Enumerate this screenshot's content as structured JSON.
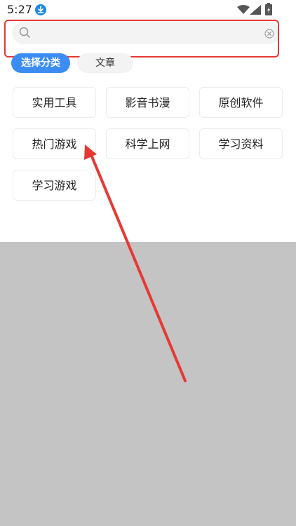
{
  "status_bar": {
    "time": "5:27",
    "icons": [
      "download-icon",
      "wifi-icon",
      "signal-icon",
      "battery-icon"
    ]
  },
  "search": {
    "placeholder": "",
    "value": ""
  },
  "tabs": [
    {
      "label": "选择分类",
      "active": true
    },
    {
      "label": "文章",
      "active": false
    }
  ],
  "categories": [
    {
      "label": "实用工具"
    },
    {
      "label": "影音书漫"
    },
    {
      "label": "原创软件"
    },
    {
      "label": "热门游戏"
    },
    {
      "label": "科学上网"
    },
    {
      "label": "学习资料"
    },
    {
      "label": "学习游戏"
    }
  ],
  "colors": {
    "accent": "#3b8df5",
    "annotation": "#e53935",
    "overlay": "#c4c4c4"
  }
}
